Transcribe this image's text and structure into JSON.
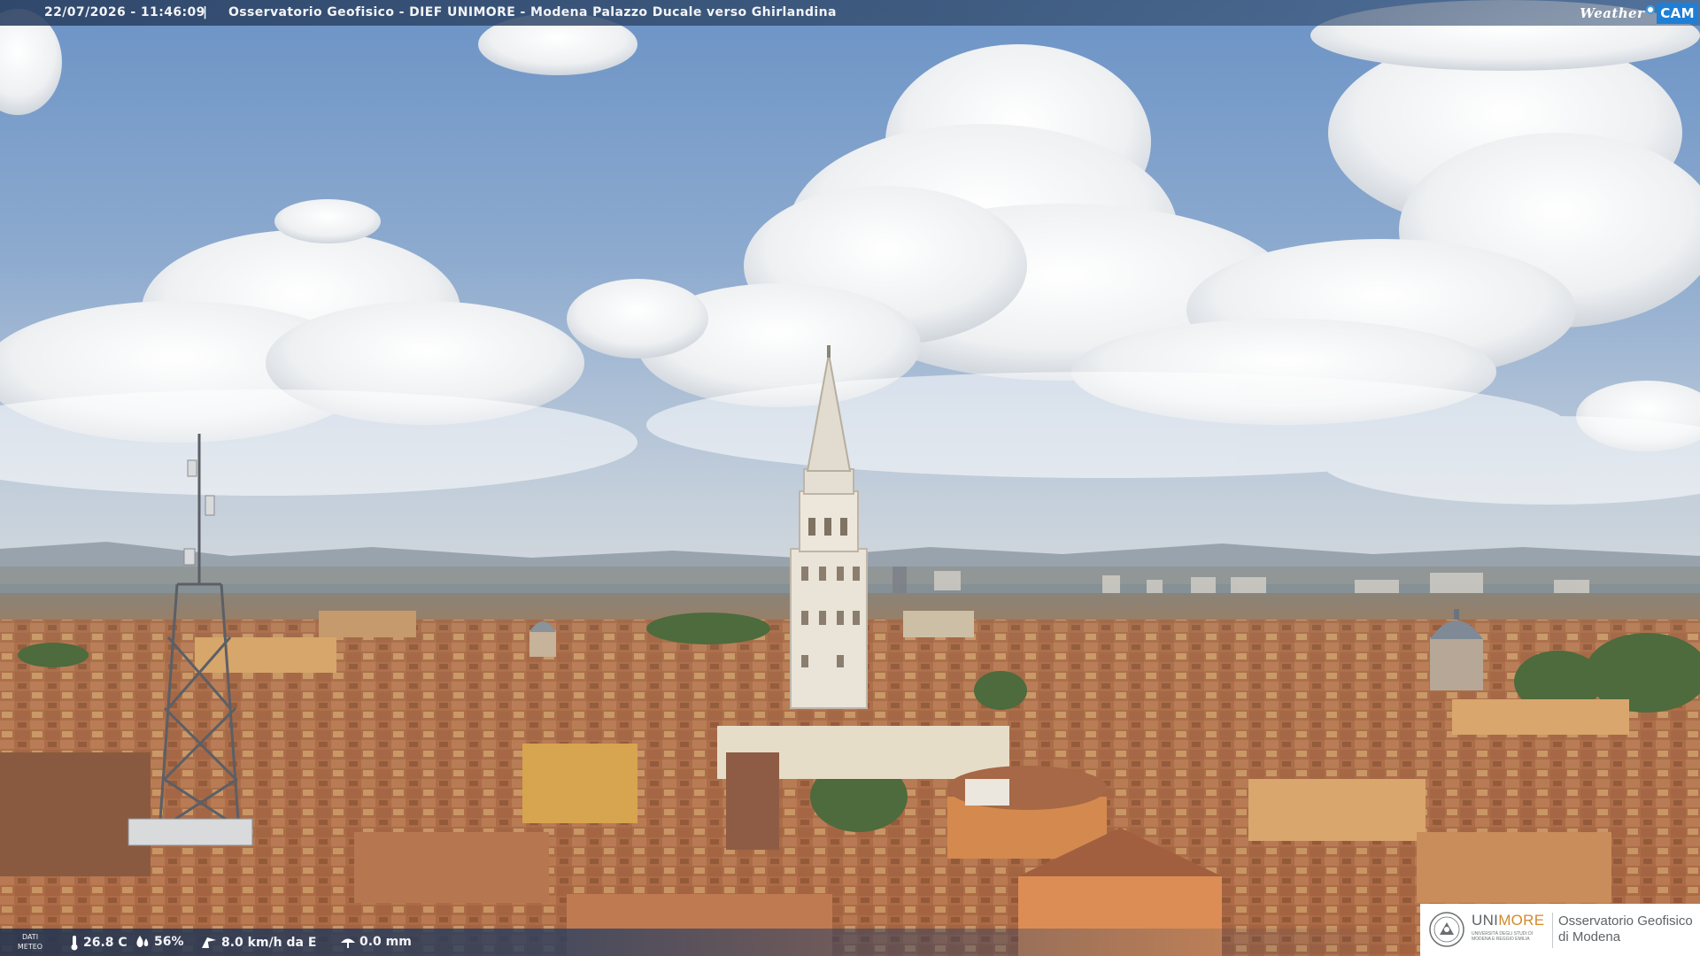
{
  "overlay": {
    "timestamp": "22/07/2026 - 11:46:09",
    "separator": "|",
    "title": "Osservatorio Geofisico - DIEF UNIMORE - Modena Palazzo Ducale verso Ghirlandina",
    "watermark_weather": "Weather",
    "watermark_cam": "CAM"
  },
  "meteo": {
    "label": "DATI METEO",
    "temperature": "26.8 C",
    "humidity": "56%",
    "wind": "8.0 km/h da E",
    "rain": "0.0 mm",
    "icons": [
      "thermometer-icon",
      "humidity-icon",
      "wind-icon",
      "rain-icon"
    ]
  },
  "logo": {
    "uni": "UNI",
    "more": "MORE",
    "subtitle": "UNIVERSITÀ DEGLI STUDI DI MODENA E REGGIO EMILIA",
    "observatory": "Osservatorio Geofisico",
    "city": "di Modena"
  },
  "colors": {
    "sky_top": "#6f95c4",
    "sky_horizon": "#c9d2db",
    "roof": "#b5734c",
    "wall": "#d9a66d",
    "tower": "#e8e2d6",
    "brand_orange": "#d28a2a",
    "cam_blue": "#1f7fd6"
  }
}
